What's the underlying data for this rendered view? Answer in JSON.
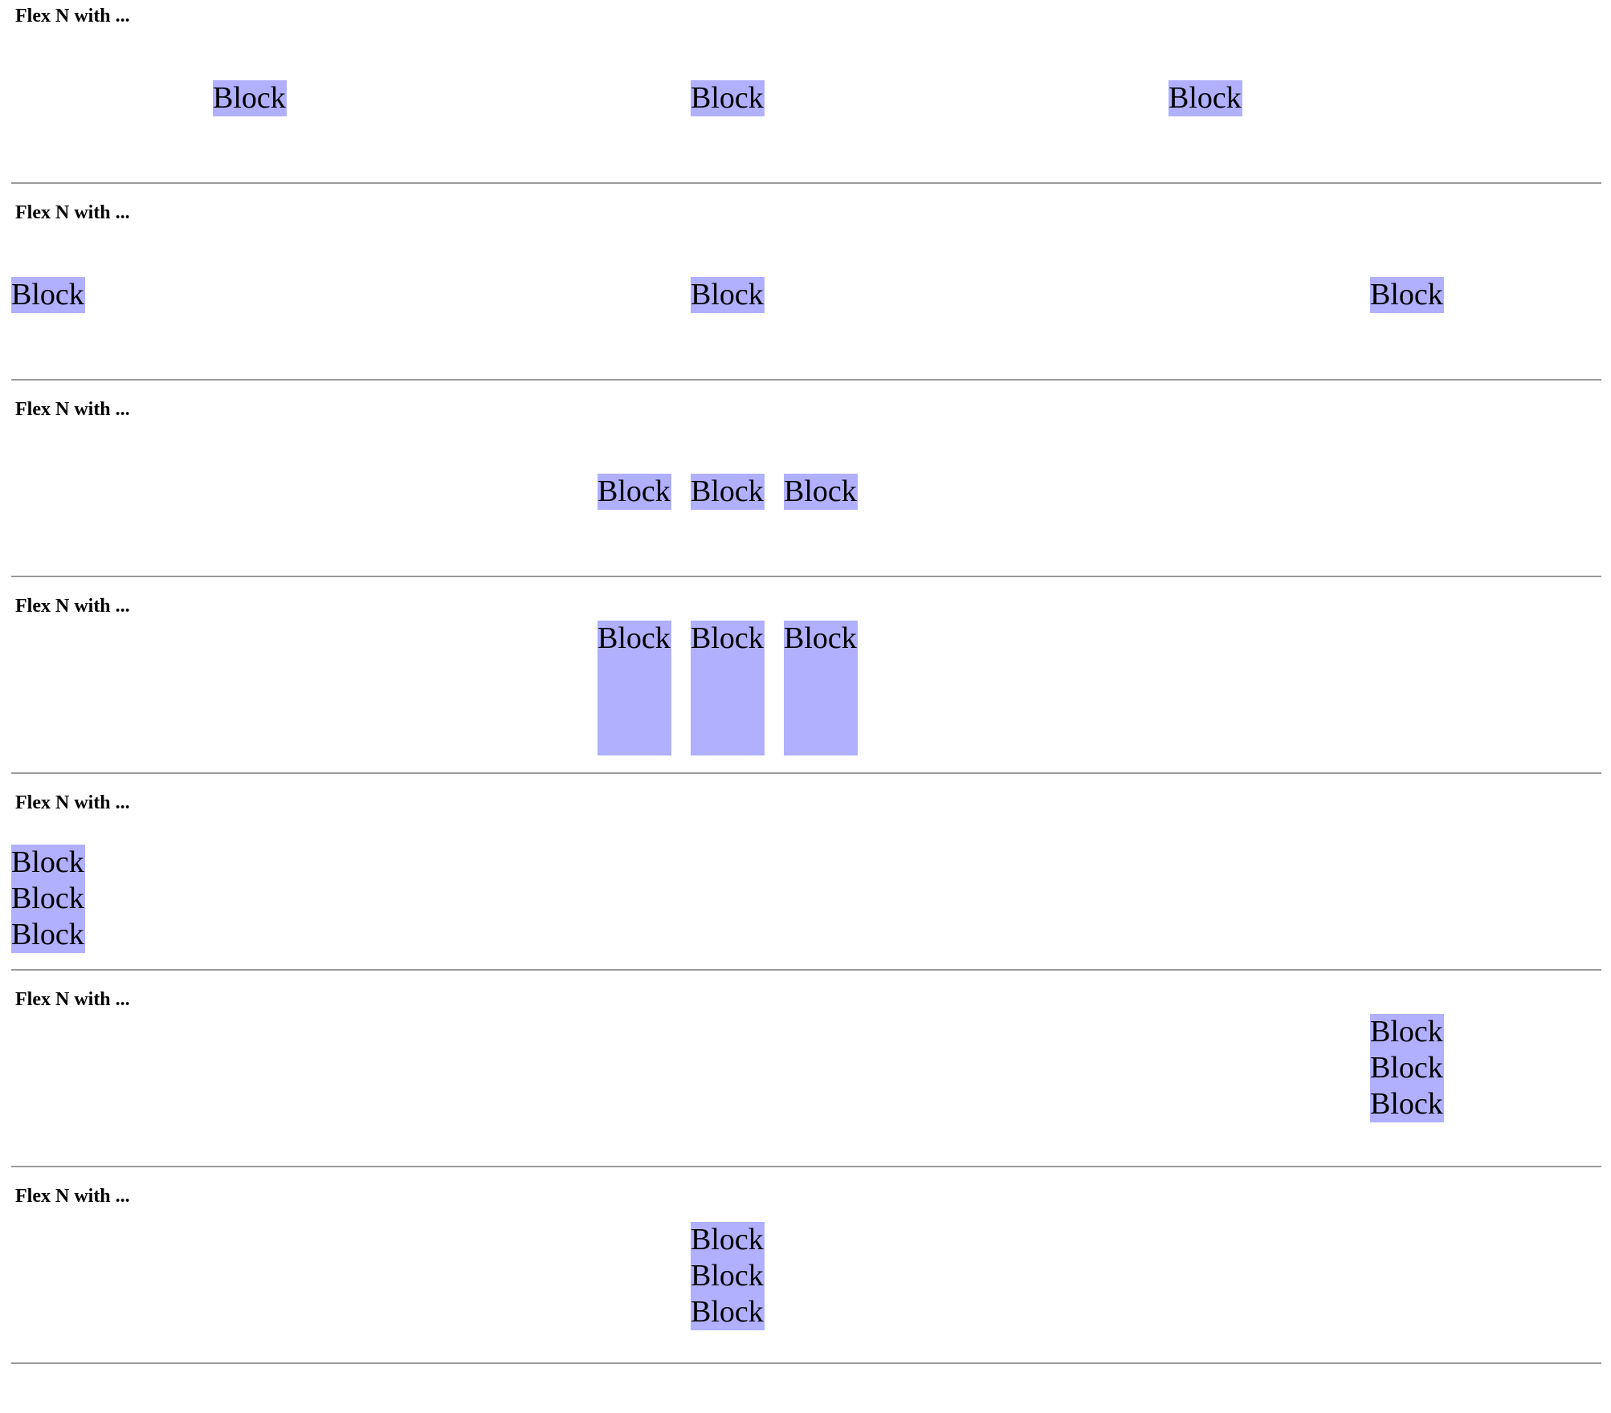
{
  "sections": [
    {
      "heading": "Flex N with ...",
      "blocks": [
        "Block",
        "Block",
        "Block"
      ]
    },
    {
      "heading": "Flex N with ...",
      "blocks": [
        "Block",
        "Block",
        "Block"
      ]
    },
    {
      "heading": "Flex N with ...",
      "blocks": [
        "Block",
        "Block",
        "Block"
      ]
    },
    {
      "heading": "Flex N with ...",
      "blocks": [
        "Block",
        "Block",
        "Block"
      ]
    },
    {
      "heading": "Flex N with ...",
      "stack_lines": [
        "Block",
        "Block",
        "Block"
      ]
    },
    {
      "heading": "Flex N with ...",
      "stack_lines": [
        "Block",
        "Block",
        "Block"
      ]
    },
    {
      "heading": "Flex N with ...",
      "stack_lines": [
        "Block",
        "Block",
        "Block"
      ]
    }
  ],
  "colors": {
    "block_background": "#b0b0ff",
    "divider": "#9a9a9a",
    "text": "#000000",
    "page_background": "#ffffff"
  }
}
